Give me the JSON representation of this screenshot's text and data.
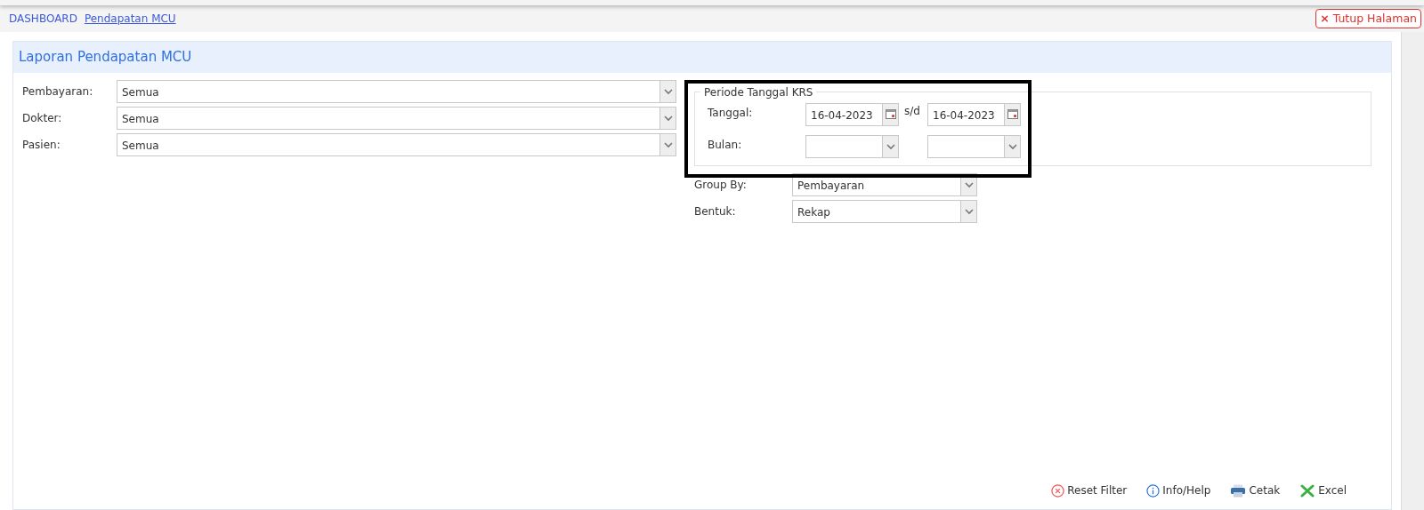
{
  "breadcrumb": [
    {
      "label": "DASHBOARD",
      "selected": false
    },
    {
      "label": "Pendapatan MCU",
      "selected": true
    }
  ],
  "close_button": {
    "icon": "×",
    "label": "Tutup Halaman"
  },
  "panel": {
    "title": "Laporan Pendapatan MCU"
  },
  "filters": [
    {
      "label": "Pembayaran:",
      "value": "Semua"
    },
    {
      "label": "Dokter:",
      "value": "Semua"
    },
    {
      "label": "Pasien:",
      "value": "Semua"
    }
  ],
  "period": {
    "legend": "Periode Tanggal KRS",
    "highlighted": true,
    "date_label": "Tanggal:",
    "date_from": "16-04-2023",
    "separator": "s/d",
    "date_to": "16-04-2023",
    "month_label": "Bulan:"
  },
  "options": [
    {
      "label": "Group By:",
      "value": "Pembayaran"
    },
    {
      "label": "Bentuk:",
      "value": "Rekap"
    }
  ],
  "actions": [
    {
      "kind": "reset",
      "label": "Reset Filter"
    },
    {
      "kind": "info",
      "label": "Info/Help"
    },
    {
      "kind": "print",
      "label": "Cetak"
    },
    {
      "kind": "excel",
      "label": "Excel"
    }
  ]
}
